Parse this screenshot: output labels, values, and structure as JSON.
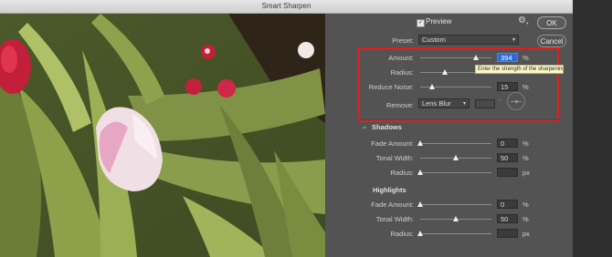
{
  "window": {
    "title": "Smart Sharpen"
  },
  "header": {
    "preview_label": "Preview",
    "preview_checked": true,
    "ok_label": "OK",
    "cancel_label": "Cancel",
    "gear_icon": "gear-icon"
  },
  "preset": {
    "label": "Preset:",
    "value": "Custom"
  },
  "main": {
    "amount": {
      "label": "Amount:",
      "value": "394",
      "unit": "%",
      "slider": 0.79
    },
    "radius": {
      "label": "Radius:",
      "value": "",
      "slider": 0.4
    },
    "reduce_noise": {
      "label": "Reduce Noise:",
      "value": "15",
      "unit": "%",
      "slider": 0.15
    },
    "remove": {
      "label": "Remove:",
      "value": "Lens Blur",
      "angle_unit": "°"
    }
  },
  "tooltip": {
    "text": "Enter the strength of the sharpening applied"
  },
  "shadows": {
    "title": "Shadows",
    "fade_amount": {
      "label": "Fade Amount:",
      "value": "0",
      "unit": "%",
      "slider": 0
    },
    "tonal_width": {
      "label": "Tonal Width:",
      "value": "50",
      "unit": "%",
      "slider": 0.5
    },
    "radius": {
      "label": "Radius:",
      "value": "",
      "unit": "px",
      "slider": 0
    }
  },
  "highlights": {
    "title": "Highlights",
    "fade_amount": {
      "label": "Fade Amount:",
      "value": "0",
      "unit": "%",
      "slider": 0
    },
    "tonal_width": {
      "label": "Tonal Width:",
      "value": "50",
      "unit": "%",
      "slider": 0.5
    },
    "radius": {
      "label": "Radius:",
      "value": "",
      "unit": "px",
      "slider": 0
    }
  },
  "colors": {
    "highlight_box": "#e0201c",
    "active_field": "#2d6bd4",
    "tooltip_bg": "#fbf8c4"
  }
}
